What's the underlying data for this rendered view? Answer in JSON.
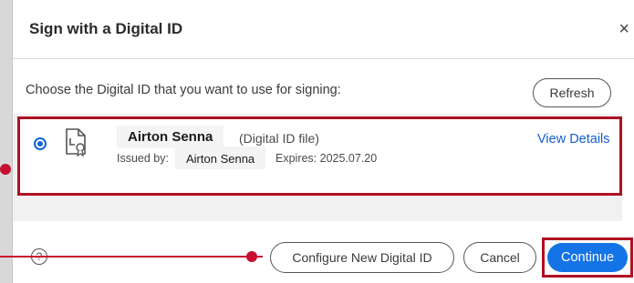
{
  "dialog": {
    "title": "Sign with a Digital ID",
    "close_glyph": "×",
    "instruction": "Choose the Digital ID that you want to use for signing:",
    "refresh_label": "Refresh"
  },
  "digital_id": {
    "selected": true,
    "name": "Airton Senna",
    "file_type": "(Digital ID file)",
    "issued_by_label": "Issued by:",
    "issuer": "Airton Senna",
    "expires": "Expires: 2025.07.20",
    "view_details": "View Details",
    "icon": "certificate-file-icon"
  },
  "footer": {
    "help_glyph": "?",
    "configure_label": "Configure New Digital ID",
    "cancel_label": "Cancel",
    "continue_label": "Continue"
  },
  "colors": {
    "accent": "#1473e6",
    "link": "#1460c8",
    "annotation": "#c8102e"
  }
}
